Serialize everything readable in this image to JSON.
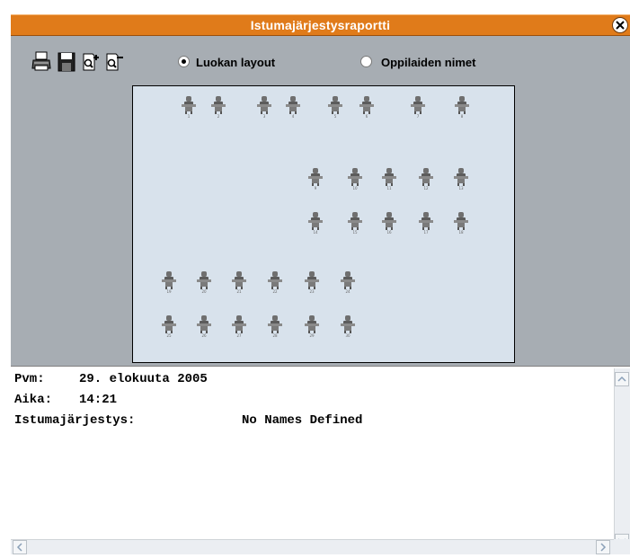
{
  "window": {
    "title": "Istumajärjestysraportti"
  },
  "toolbar": {
    "print_icon": "printer-icon",
    "save_icon": "floppy-disk-icon",
    "zoom_in_icon": "zoom-in-icon",
    "zoom_out_icon": "zoom-out-icon",
    "view_options": [
      {
        "label": "Luokan layout",
        "selected": true
      },
      {
        "label": "Oppilaiden nimet",
        "selected": false
      }
    ]
  },
  "layout": {
    "desks": [
      {
        "n": "1"
      },
      {
        "n": "2"
      },
      {
        "n": "3"
      },
      {
        "n": "4"
      },
      {
        "n": "5"
      },
      {
        "n": "6"
      },
      {
        "n": "7"
      },
      {
        "n": "8"
      },
      {
        "n": "9"
      },
      {
        "n": "10"
      },
      {
        "n": "11"
      },
      {
        "n": "12"
      },
      {
        "n": "13"
      },
      {
        "n": "14"
      },
      {
        "n": "15"
      },
      {
        "n": "16"
      },
      {
        "n": "17"
      },
      {
        "n": "18"
      },
      {
        "n": "19"
      },
      {
        "n": "20"
      },
      {
        "n": "21"
      },
      {
        "n": "22"
      },
      {
        "n": "23"
      },
      {
        "n": "24"
      },
      {
        "n": "25"
      },
      {
        "n": "26"
      },
      {
        "n": "27"
      },
      {
        "n": "28"
      },
      {
        "n": "29"
      },
      {
        "n": "30"
      }
    ]
  },
  "report": {
    "date_label": "Pvm:",
    "date_value": "29. elokuuta 2005",
    "time_label": "Aika:",
    "time_value": "14:21",
    "seating_label": "Istumajärjestys:",
    "seating_value": "No Names Defined"
  },
  "colors": {
    "title_bar": "#e07b1a",
    "panel": "#a7adb3",
    "canvas": "#d8e2ec"
  }
}
